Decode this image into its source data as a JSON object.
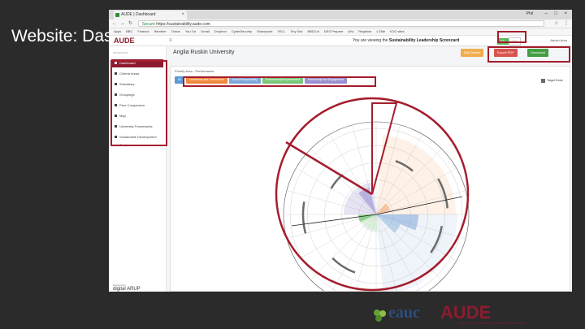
{
  "slide": {
    "title": "Website: Dashboard"
  },
  "browser": {
    "tab_title": "AUDE | Dashboard",
    "url_secure": "Secure",
    "url": "https://sustainability.aude.com",
    "user": "Phil",
    "bookmarks": [
      "Apps",
      "BBC",
      "Finance",
      "Weather",
      "Tuinar",
      "You Tut",
      "Gmail",
      "Dropbox",
      "CyberSecurity",
      "Sharepoint",
      "YELL",
      "Tiny Dict",
      "BBDCol",
      "DES Prepare",
      "Ufvl",
      "Registrar",
      "LCMe",
      "ICIO sites"
    ]
  },
  "app": {
    "logo": "AUDE",
    "menu_icon": "menu-icon",
    "viewing_prefix": "You are viewing the",
    "viewing_strong": "Sustainability Leadership Scorecard",
    "lang_on": "EN",
    "lang_off": "CY",
    "admin": "Admin Area",
    "university": "Anglia Ruskin University",
    "buttons": [
      {
        "label": "Edit Details",
        "color": "#f0ad4e"
      },
      {
        "label": "Export PDF",
        "color": "#d9534f"
      },
      {
        "label": "Download",
        "color": "#449d44"
      }
    ]
  },
  "sidebar": {
    "header": "NAVIGATION",
    "items": [
      {
        "label": "Dashboard",
        "active": true
      },
      {
        "label": "Criteria Areas",
        "active": false
      },
      {
        "label": "Subsidiary",
        "active": false
      },
      {
        "label": "Groupings",
        "active": false
      },
      {
        "label": "Peer Comparison",
        "active": false
      },
      {
        "label": "Map",
        "active": false
      },
      {
        "label": "University Frameworks",
        "active": false
      },
      {
        "label": "Sustainable Development Goals",
        "active": false
      }
    ],
    "powered_by": "Powered by",
    "brand": "digital ARUP"
  },
  "panel": {
    "title": "Priority Area - Performance",
    "filters": [
      {
        "label": "All",
        "color": "#5b9bd5"
      },
      {
        "label": "Leadership and Governance",
        "color": "#f0883e"
      },
      {
        "label": "Social Responsibility",
        "color": "#7fa6d8"
      },
      {
        "label": "Environmental Improvement",
        "color": "#78c878"
      },
      {
        "label": "Partnership and Engagement",
        "color": "#9b8fd0"
      }
    ],
    "legend": "Target Score",
    "colors": {
      "leadership": "#f0883e",
      "social": "#7fa6d8",
      "environment": "#78c878",
      "partnership": "#9b8fd0",
      "target": "#6b6b6b"
    }
  },
  "footer": {
    "eauc": "eauc",
    "aude": "AUDE",
    "aude_sub": "ASSOCIATION OF UNIVERSITY DIRECTORS OF ESTATES"
  }
}
